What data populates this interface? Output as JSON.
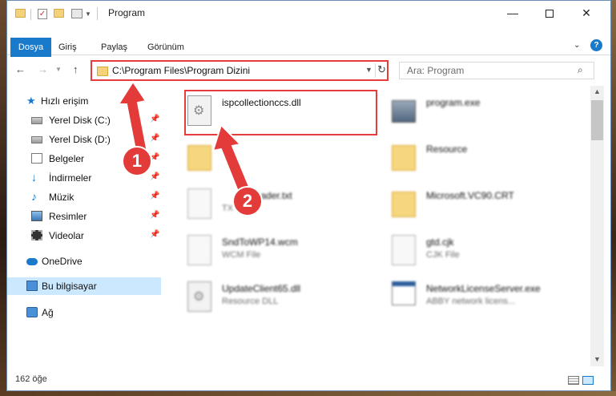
{
  "window": {
    "title": "Program"
  },
  "ribbon": {
    "tabs": [
      "Dosya",
      "Giriş",
      "Paylaş",
      "Görünüm"
    ],
    "help_label": "?"
  },
  "navigation": {
    "address": "C:\\Program Files\\Program Dizini",
    "search_placeholder": "Ara: Program"
  },
  "sidebar": {
    "quick_access": "Hızlı erişim",
    "items": [
      {
        "label": "Yerel Disk (C:)",
        "icon": "drive-icon",
        "pinned": true
      },
      {
        "label": "Yerel Disk (D:)",
        "icon": "drive-icon",
        "pinned": true
      },
      {
        "label": "Belgeler",
        "icon": "documents-icon",
        "pinned": true
      },
      {
        "label": "İndirmeler",
        "icon": "download-icon",
        "pinned": true
      },
      {
        "label": "Müzik",
        "icon": "music-icon",
        "pinned": true
      },
      {
        "label": "Resimler",
        "icon": "pictures-icon",
        "pinned": true
      },
      {
        "label": "Videolar",
        "icon": "videos-icon",
        "pinned": true
      }
    ],
    "onedrive": "OneDrive",
    "this_pc": "Bu bilgisayar",
    "network": "Ağ"
  },
  "files": [
    {
      "name": "ispcollectionccs.dll",
      "type": "",
      "icon": "dll-icon",
      "highlighted": true
    },
    {
      "name": "program.exe",
      "type": "",
      "icon": "exe-icon",
      "highlighted": false
    },
    {
      "name": "",
      "type": "",
      "icon": "folder-icon",
      "highlighted": false
    },
    {
      "name": "Resource",
      "type": "",
      "icon": "folder-icon",
      "highlighted": false
    },
    {
      "name": "Reader.txt",
      "type": "TX",
      "icon": "text-file-icon",
      "highlighted": false
    },
    {
      "name": "Microsoft.VC90.CRT",
      "type": "",
      "icon": "folder-icon",
      "highlighted": false
    },
    {
      "name": "SndToWP14.wcm",
      "type": "WCM File",
      "icon": "file-icon",
      "highlighted": false
    },
    {
      "name": "gtd.cjk",
      "type": "CJK File",
      "icon": "file-icon",
      "highlighted": false
    },
    {
      "name": "UpdateClient65.dll",
      "type": "Resource DLL",
      "icon": "dll-icon",
      "highlighted": false
    },
    {
      "name": "NetworkLicenseServer.exe",
      "type": "ABBY network licens...",
      "icon": "exe-icon",
      "highlighted": false
    }
  ],
  "callouts": [
    "1",
    "2"
  ],
  "status": {
    "item_count": "162 öğe"
  },
  "colors": {
    "accent": "#1979ca",
    "highlight": "#e63c3c",
    "selected": "#cce8ff"
  }
}
